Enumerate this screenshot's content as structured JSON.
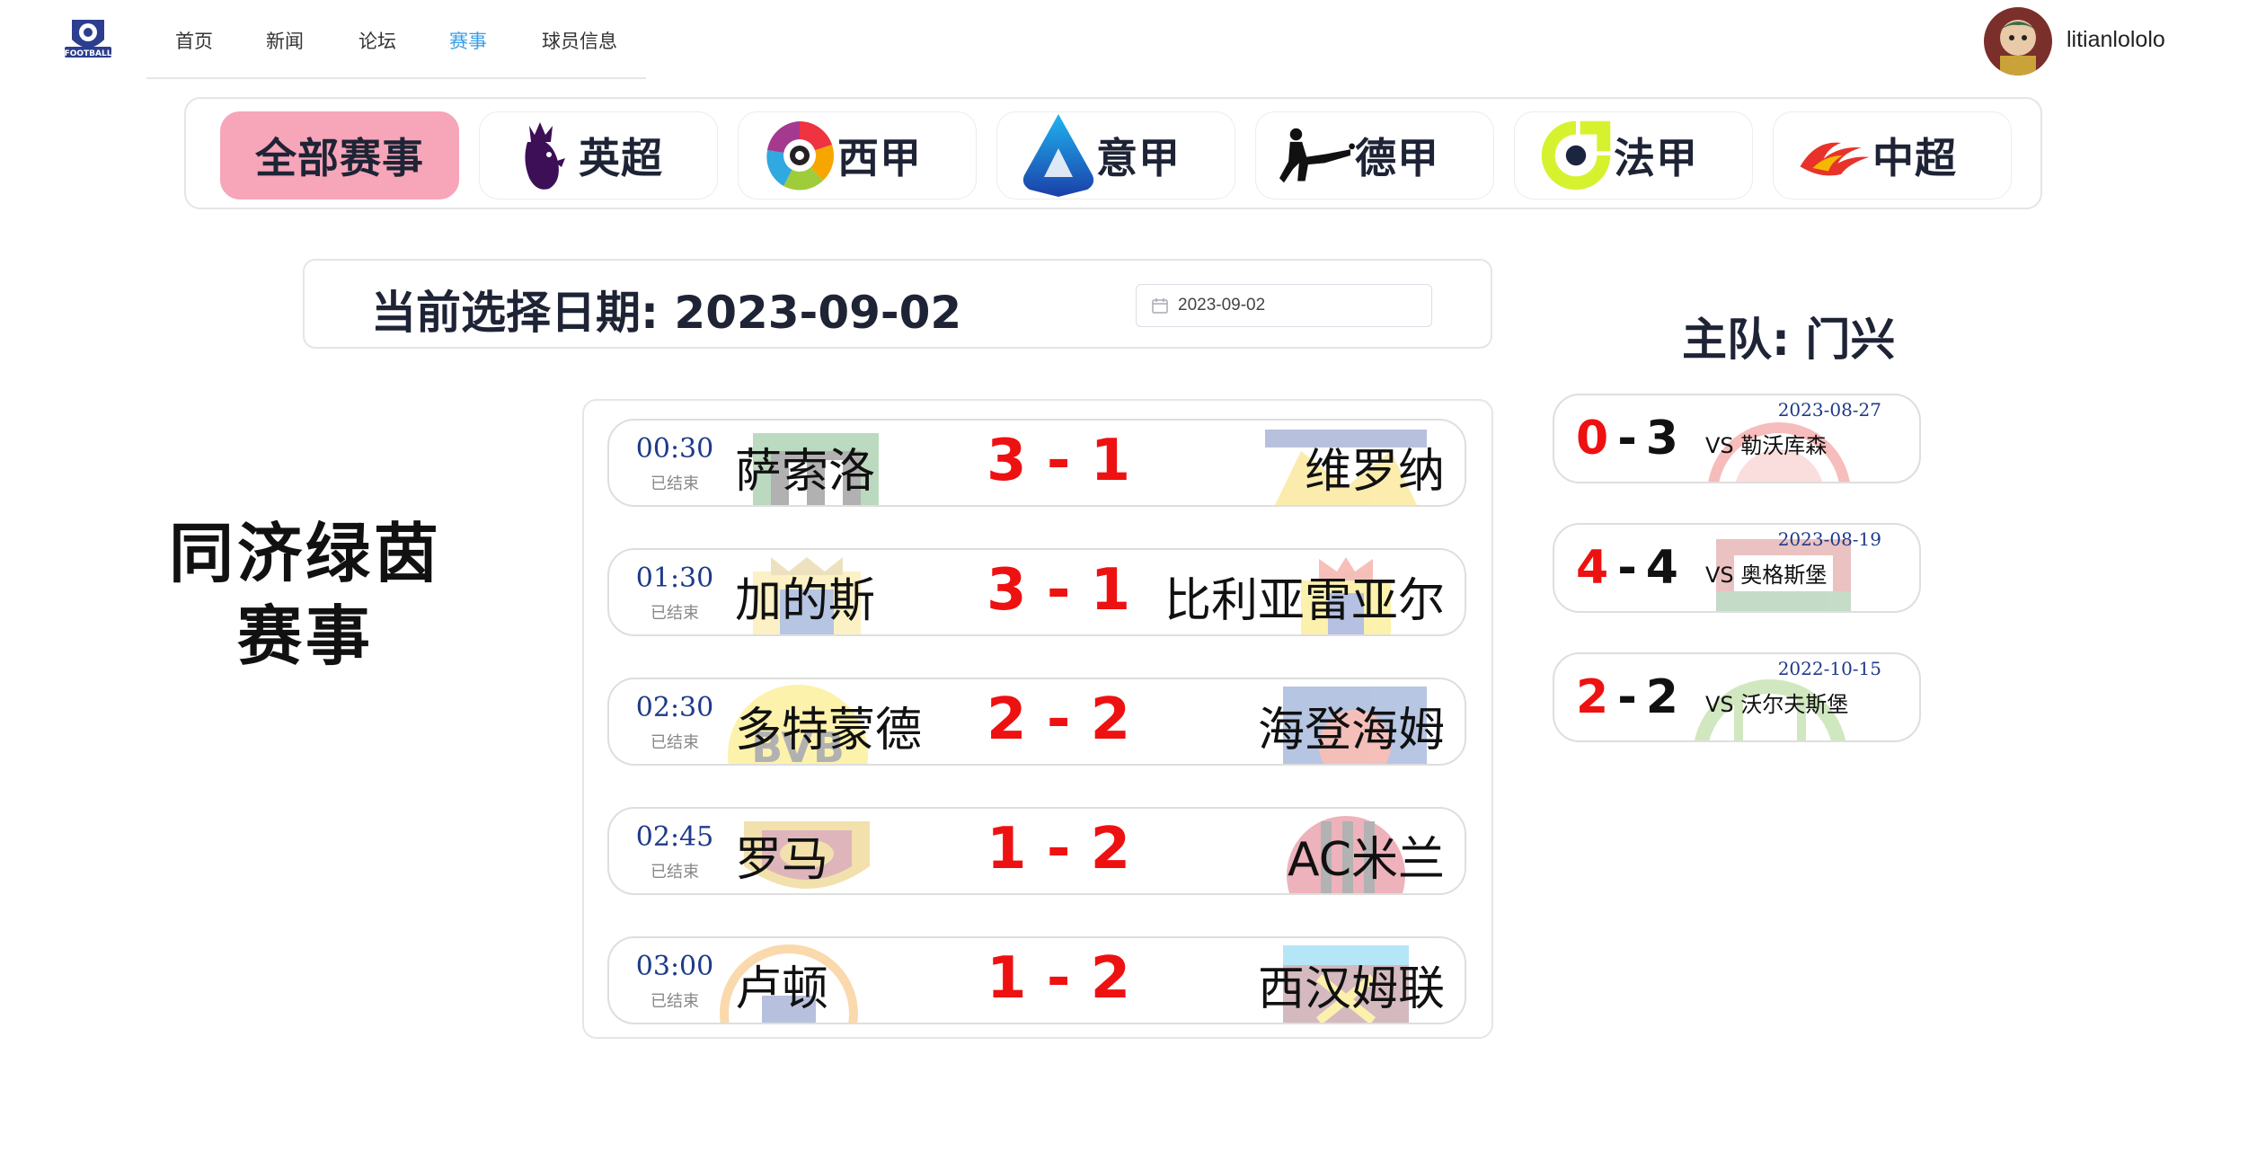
{
  "nav": {
    "logo_text": "FOOTBALL",
    "items": [
      {
        "label": "首页",
        "active": false
      },
      {
        "label": "新闻",
        "active": false
      },
      {
        "label": "论坛",
        "active": false
      },
      {
        "label": "赛事",
        "active": true
      },
      {
        "label": "球员信息",
        "active": false
      }
    ],
    "active_color": "#3a9ee6"
  },
  "user": {
    "name": "litianlololo"
  },
  "leagues": [
    {
      "label": "全部赛事",
      "icon": "all",
      "active": true
    },
    {
      "label": "英超",
      "icon": "premier-league-icon",
      "active": false
    },
    {
      "label": "西甲",
      "icon": "laliga-icon",
      "active": false
    },
    {
      "label": "意甲",
      "icon": "serie-a-icon",
      "active": false
    },
    {
      "label": "德甲",
      "icon": "bundesliga-icon",
      "active": false
    },
    {
      "label": "法甲",
      "icon": "ligue1-icon",
      "active": false
    },
    {
      "label": "中超",
      "icon": "csl-icon",
      "active": false
    }
  ],
  "date": {
    "title": "当前选择日期: 2023-09-02",
    "input_value": "2023-09-02"
  },
  "side_title": {
    "line1": "同济绿茵",
    "line2": "赛事"
  },
  "matches": [
    {
      "time": "00:30",
      "status": "已结束",
      "home": "萨索洛",
      "score": "3 - 1",
      "away": "维罗纳"
    },
    {
      "time": "01:30",
      "status": "已结束",
      "home": "加的斯",
      "score": "3 - 1",
      "away": "比利亚雷亚尔"
    },
    {
      "time": "02:30",
      "status": "已结束",
      "home": "多特蒙德",
      "score": "2 - 2",
      "away": "海登海姆"
    },
    {
      "time": "02:45",
      "status": "已结束",
      "home": "罗马",
      "score": "1 - 2",
      "away": "AC米兰"
    },
    {
      "time": "03:00",
      "status": "已结束",
      "home": "卢顿",
      "score": "1 - 2",
      "away": "西汉姆联"
    }
  ],
  "history": {
    "title": "主队: 门兴",
    "items": [
      {
        "date": "2023-08-27",
        "home_score": "0",
        "away_score": "3",
        "vs": "VS",
        "opponent": "勒沃库森"
      },
      {
        "date": "2023-08-19",
        "home_score": "4",
        "away_score": "4",
        "vs": "VS",
        "opponent": "奥格斯堡"
      },
      {
        "date": "2022-10-15",
        "home_score": "2",
        "away_score": "2",
        "vs": "VS",
        "opponent": "沃尔夫斯堡"
      }
    ]
  },
  "colors": {
    "score_red": "#ee1111",
    "active_tab_pink": "#f7a5b9",
    "time_blue": "#1e3a8a"
  }
}
